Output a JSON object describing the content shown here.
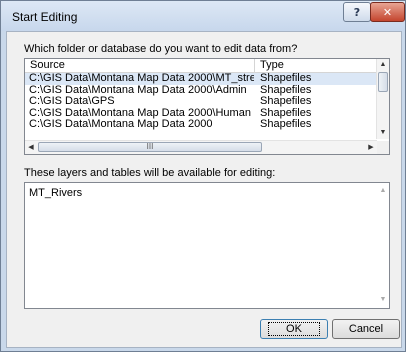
{
  "window": {
    "title": "Start Editing",
    "help_label": "?",
    "close_label": "✕"
  },
  "question_label": "Which folder or database do you want to edit data from?",
  "sources": {
    "columns": [
      "Source",
      "Type"
    ],
    "rows": [
      {
        "source": "C:\\GIS Data\\Montana Map Data 2000\\MT_stre...",
        "type": "Shapefiles",
        "selected": true
      },
      {
        "source": "C:\\GIS Data\\Montana Map Data 2000\\Admin",
        "type": "Shapefiles",
        "selected": false
      },
      {
        "source": "C:\\GIS Data\\GPS",
        "type": "Shapefiles",
        "selected": false
      },
      {
        "source": "C:\\GIS Data\\Montana Map Data 2000\\Human",
        "type": "Shapefiles",
        "selected": false
      },
      {
        "source": "C:\\GIS Data\\Montana Map Data 2000",
        "type": "Shapefiles",
        "selected": false
      }
    ],
    "hscroll_grip": "III"
  },
  "layers_label": "These layers and tables will be available for editing:",
  "layers": [
    "MT_Rivers"
  ],
  "buttons": {
    "ok": "OK",
    "cancel": "Cancel"
  },
  "colors": {
    "titlebar": "#c7d7ec",
    "close_button": "#c4452e",
    "selection": "#dbe7f6"
  }
}
